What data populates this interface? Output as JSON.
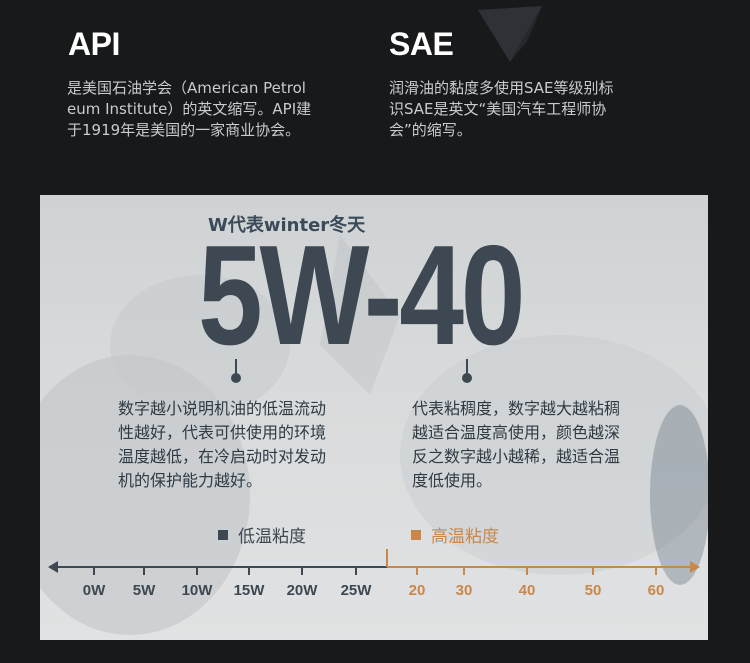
{
  "api": {
    "title": "API",
    "desc_lines": [
      "是美国石油学会（American Petrol",
      "eum Institute）的英文缩写。API建",
      "于1919年是美国的一家商业协会。"
    ]
  },
  "sae": {
    "title": "SAE",
    "desc_lines": [
      "润滑油的黏度多使用SAE等级别标",
      "识SAE是英文“美国汽车工程师协",
      "会”的缩写。"
    ]
  },
  "grade": {
    "w_label": "W代表winter冬天",
    "code": "5W-40",
    "left_desc_lines": [
      "数字越小说明机油的低温流动",
      "性越好，代表可供使用的环境",
      "温度越低，在冷启动时对发动",
      "机的保护能力越好。"
    ],
    "right_desc_lines": [
      "代表粘稠度，数字越大越粘稠",
      "越适合温度高使用，颜色越深",
      "反之数字越小越稀，越适合温",
      "度低使用。"
    ]
  },
  "legend": {
    "low_label": "低温粘度",
    "high_label": "高温粘度"
  },
  "scale": {
    "low_ticks": [
      "0W",
      "5W",
      "10W",
      "15W",
      "20W",
      "25W"
    ],
    "high_ticks": [
      "20",
      "30",
      "40",
      "50",
      "60"
    ]
  },
  "colors": {
    "dark": "#3d4852",
    "accent": "#c9874a",
    "background": "#17191b"
  }
}
